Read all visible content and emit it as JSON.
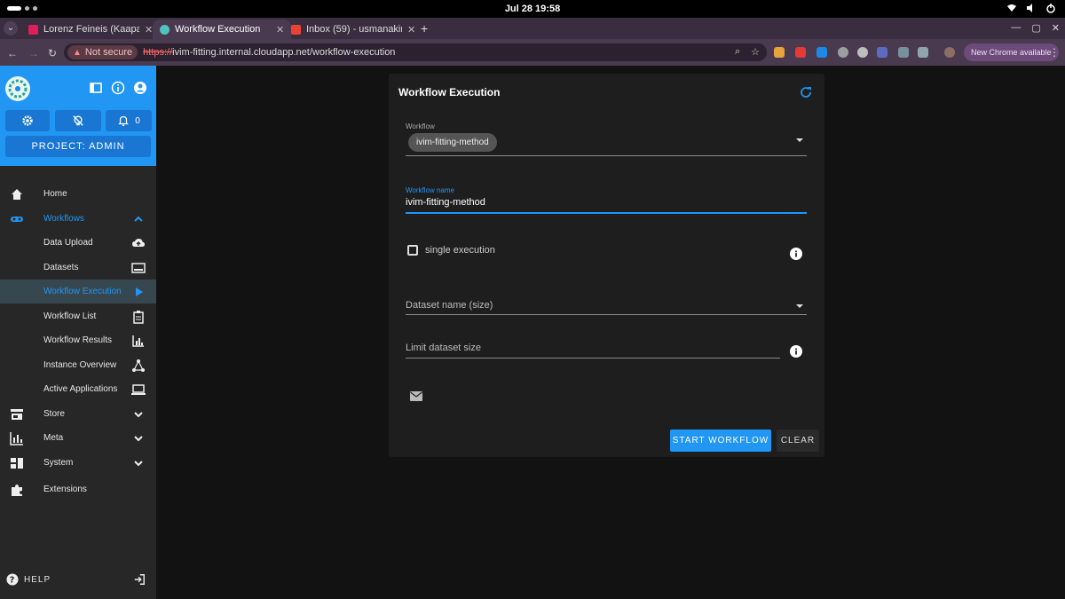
{
  "os": {
    "clock": "Jul 28  19:58"
  },
  "browser": {
    "tabs": [
      {
        "title": "Lorenz Feineis (Kaapana",
        "color": "#e01e5a"
      },
      {
        "title": "Workflow Execution",
        "color": "#4fc3c0"
      },
      {
        "title": "Inbox (59) - usmanakin",
        "color": "#ea4335"
      }
    ],
    "security_label": "Not secure",
    "url_scheme": "https://",
    "url_rest": "ivim-fitting.internal.cloudapp.net/workflow-execution",
    "new_chrome_label": "New Chrome available"
  },
  "sidebar": {
    "notification_count": "0",
    "project_label": "PROJECT: ADMIN",
    "items": [
      {
        "label": "Home",
        "icon": "home-icon"
      },
      {
        "label": "Workflows",
        "icon": "workflows-icon"
      },
      {
        "label": "Data Upload",
        "icon": "cloud-upload-icon"
      },
      {
        "label": "Datasets",
        "icon": "dataset-icon"
      },
      {
        "label": "Workflow Execution",
        "icon": "play-icon"
      },
      {
        "label": "Workflow List",
        "icon": "clipboard-icon"
      },
      {
        "label": "Workflow Results",
        "icon": "chart-icon"
      },
      {
        "label": "Instance Overview",
        "icon": "network-icon"
      },
      {
        "label": "Active Applications",
        "icon": "laptop-icon"
      },
      {
        "label": "Store",
        "icon": "store-icon"
      },
      {
        "label": "Meta",
        "icon": "meta-chart-icon"
      },
      {
        "label": "System",
        "icon": "system-icon"
      },
      {
        "label": "Extensions",
        "icon": "puzzle-icon"
      }
    ],
    "help_label": "HELP"
  },
  "card": {
    "title": "Workflow Execution",
    "workflow_label": "Workflow",
    "workflow_value": "ivim-fitting-method",
    "workflow_name_label": "Workflow name",
    "workflow_name_value": "ivim-fitting-method",
    "single_execution_label": "single execution",
    "dataset_placeholder": "Dataset name (size)",
    "limit_placeholder": "Limit dataset size",
    "start_label": "START WORKFLOW",
    "clear_label": "CLEAR"
  }
}
